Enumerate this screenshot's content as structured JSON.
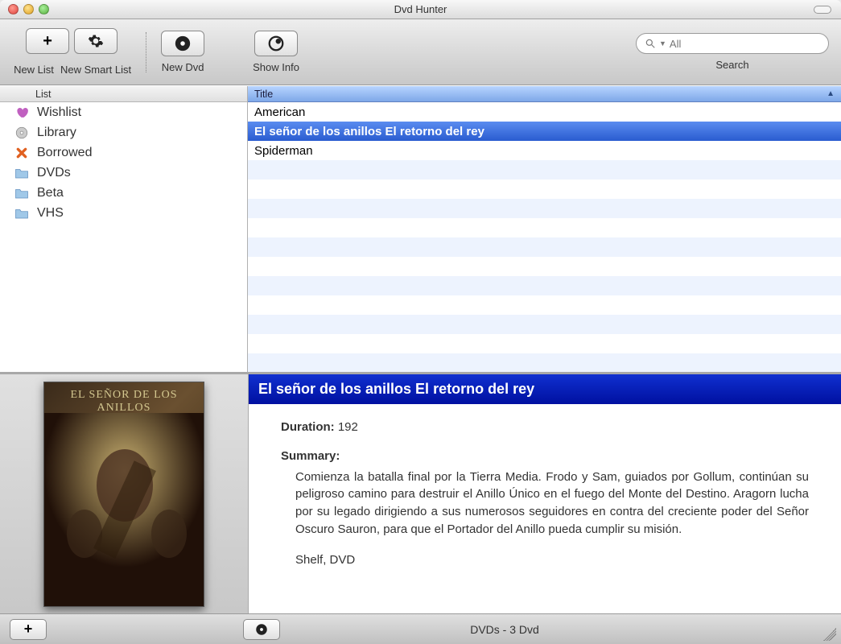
{
  "window": {
    "title": "Dvd Hunter"
  },
  "toolbar": {
    "new_list": "New List",
    "new_smart_list": "New Smart List",
    "new_dvd": "New Dvd",
    "show_info": "Show Info",
    "search_label": "Search",
    "search_placeholder": "All"
  },
  "sidebar": {
    "header": "List",
    "items": [
      {
        "icon": "heart",
        "label": "Wishlist"
      },
      {
        "icon": "disc",
        "label": "Library"
      },
      {
        "icon": "x",
        "label": "Borrowed"
      },
      {
        "icon": "folder",
        "label": "DVDs"
      },
      {
        "icon": "folder",
        "label": "Beta"
      },
      {
        "icon": "folder",
        "label": "VHS"
      }
    ]
  },
  "table": {
    "header": "Title",
    "rows": [
      {
        "title": "American",
        "selected": false
      },
      {
        "title": "El señor de los anillos El retorno del rey",
        "selected": true
      },
      {
        "title": "Spiderman",
        "selected": false
      }
    ]
  },
  "detail": {
    "cover_title": "EL SEÑOR DE LOS ANILLOS",
    "title": "El señor de los anillos El retorno del rey",
    "duration_label": "Duration:",
    "duration_value": "192",
    "summary_label": "Summary:",
    "summary_text": "Comienza la batalla final por la Tierra Media. Frodo y Sam, guiados por Gollum, continúan su peligroso camino para destruir el Anillo Único en el fuego del Monte del Destino. Aragorn lucha por su legado dirigiendo a sus numerosos seguidores en contra del creciente poder del Señor Oscuro Sauron, para que el Portador del Anillo pueda cumplir su misión.",
    "shelf": "Shelf, DVD"
  },
  "status": {
    "text": "DVDs - 3 Dvd"
  }
}
